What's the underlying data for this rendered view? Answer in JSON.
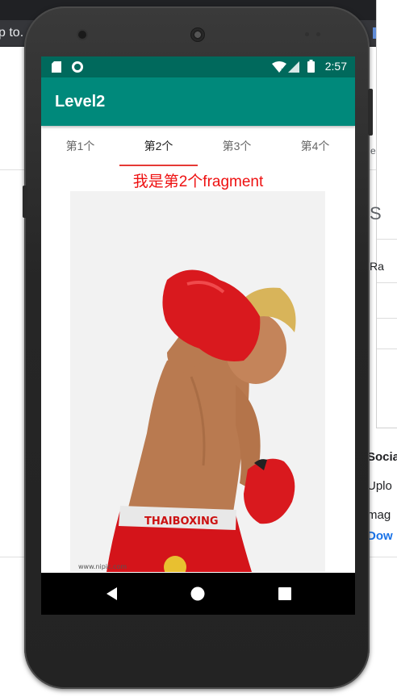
{
  "background": {
    "url_fragment": "p to.",
    "right_snippets": [
      "Socia",
      "Uplo",
      "mag",
      "Dow"
    ],
    "panel_glyphs": [
      "-",
      "←",
      "↻",
      "S",
      "Ra"
    ]
  },
  "status_bar": {
    "time": "2:57",
    "icons": [
      "sd-card-icon",
      "circle-notification-icon",
      "wifi-icon",
      "signal-icon",
      "battery-icon"
    ]
  },
  "app_bar": {
    "title": "Level2"
  },
  "tabs": [
    {
      "label": "第1个",
      "active": false
    },
    {
      "label": "第2个",
      "active": true
    },
    {
      "label": "第3个",
      "active": false
    },
    {
      "label": "第4个",
      "active": false
    }
  ],
  "fragment": {
    "text": "我是第2个fragment"
  },
  "photo": {
    "description_icon": "boxer-photo",
    "shorts_text": "THAIBOXING",
    "watermark": "www.nipic.com"
  },
  "navigation": {
    "buttons": [
      "back-icon",
      "home-icon",
      "recents-icon"
    ]
  },
  "colors": {
    "status_bar": "#00695c",
    "app_bar": "#00897b",
    "accent": "#e53935",
    "fragment_text": "#ee1111"
  }
}
